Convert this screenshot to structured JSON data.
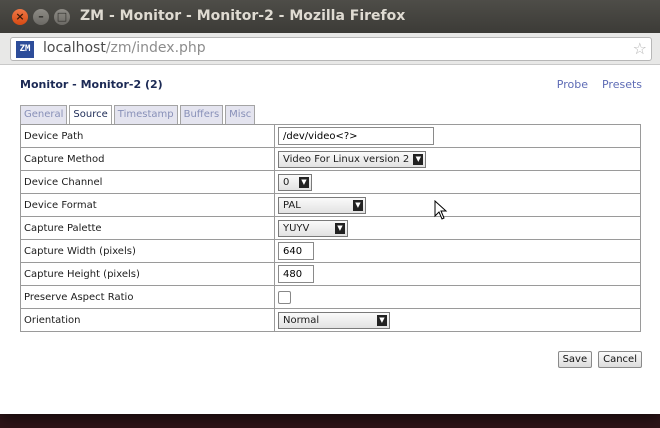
{
  "window": {
    "title": "ZM - Monitor - Monitor-2 - Mozilla Firefox"
  },
  "browser": {
    "site_icon": "ZM",
    "url_host": "localhost",
    "url_path": "/zm/index.php"
  },
  "page": {
    "title": "Monitor - Monitor-2 (2)",
    "links": [
      {
        "label": "Probe"
      },
      {
        "label": "Presets"
      }
    ],
    "tabs": [
      {
        "label": "General",
        "active": false
      },
      {
        "label": "Source",
        "active": true
      },
      {
        "label": "Timestamp",
        "active": false
      },
      {
        "label": "Buffers",
        "active": false
      },
      {
        "label": "Misc",
        "active": false
      }
    ],
    "fields": {
      "device_path": {
        "label": "Device Path",
        "value": "/dev/video<?>"
      },
      "capture_method": {
        "label": "Capture Method",
        "value": "Video For Linux version 2"
      },
      "device_channel": {
        "label": "Device Channel",
        "value": "0"
      },
      "device_format": {
        "label": "Device Format",
        "value": "PAL"
      },
      "capture_palette": {
        "label": "Capture Palette",
        "value": "YUYV"
      },
      "capture_width": {
        "label": "Capture Width (pixels)",
        "value": "640"
      },
      "capture_height": {
        "label": "Capture Height (pixels)",
        "value": "480"
      },
      "preserve_aspect": {
        "label": "Preserve Aspect Ratio",
        "checked": false
      },
      "orientation": {
        "label": "Orientation",
        "value": "Normal"
      }
    },
    "buttons": {
      "save": "Save",
      "cancel": "Cancel"
    }
  }
}
